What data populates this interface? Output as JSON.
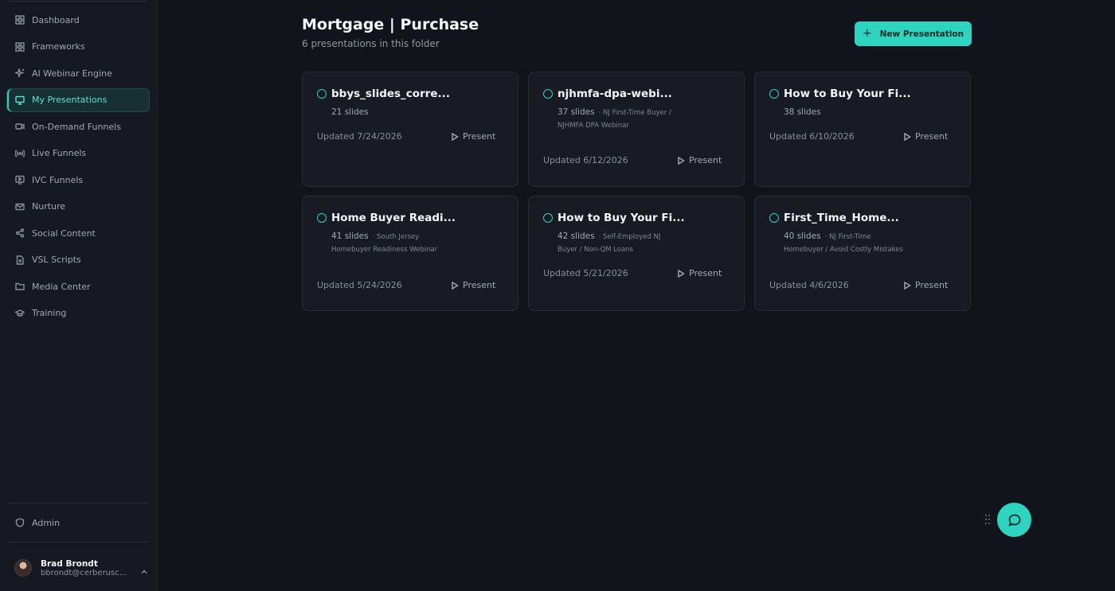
{
  "sidebar": {
    "items": [
      {
        "label": "Dashboard",
        "icon": "dashboard-grid-icon"
      },
      {
        "label": "Frameworks",
        "icon": "frameworks-grid-icon"
      },
      {
        "label": "AI Webinar Engine",
        "icon": "sparkles-icon"
      },
      {
        "label": "My Presentations",
        "icon": "presentation-icon",
        "active": true
      },
      {
        "label": "On-Demand Funnels",
        "icon": "video-camera-icon"
      },
      {
        "label": "Live Funnels",
        "icon": "broadcast-icon"
      },
      {
        "label": "IVC Funnels",
        "icon": "screen-play-icon"
      },
      {
        "label": "Nurture",
        "icon": "mail-icon"
      },
      {
        "label": "Social Content",
        "icon": "share-icon"
      },
      {
        "label": "VSL Scripts",
        "icon": "document-icon"
      },
      {
        "label": "Media Center",
        "icon": "folder-icon"
      },
      {
        "label": "Training",
        "icon": "graduation-cap-icon"
      }
    ],
    "admin": {
      "label": "Admin",
      "icon": "shield-icon"
    },
    "user": {
      "name": "Brad Brondt",
      "email": "bbrondt@cerberusc..."
    }
  },
  "header": {
    "title": "Mortgage | Purchase",
    "subtitle": "6 presentations in this folder",
    "new_button": "New Presentation",
    "new_button_icon": "+"
  },
  "cards": [
    {
      "title": "bbys_slides_corre...",
      "count": "21 slides",
      "desc": "",
      "updated": "Updated 7/24/2026",
      "present": "Present"
    },
    {
      "title": "njhmfa-dpa-webi...",
      "count": "37 slides",
      "desc": "· NJ First-Time Buyer / NJHMFA DPA Webinar",
      "updated": "Updated 6/12/2026",
      "present": "Present"
    },
    {
      "title": "How to Buy Your Fi...",
      "count": "38 slides",
      "desc": "",
      "updated": "Updated 6/10/2026",
      "present": "Present"
    },
    {
      "title": "Home Buyer Readi...",
      "count": "41 slides",
      "desc": "· South Jersey Homebuyer Readiness Webinar",
      "updated": "Updated 5/24/2026",
      "present": "Present"
    },
    {
      "title": "How to Buy Your Fi...",
      "count": "42 slides",
      "desc": "· Self-Employed NJ Buyer / Non-QM Loans",
      "updated": "Updated 5/21/2026",
      "present": "Present"
    },
    {
      "title": "First_Time_Home...",
      "count": "40 slides",
      "desc": "· NJ First-Time Homebuyer / Avoid Costly Mistakes",
      "updated": "Updated 4/6/2026",
      "present": "Present"
    }
  ],
  "colors": {
    "accent": "#2dd4bf",
    "background": "#12141b",
    "sidebar": "#161922",
    "card": "#181b24"
  }
}
